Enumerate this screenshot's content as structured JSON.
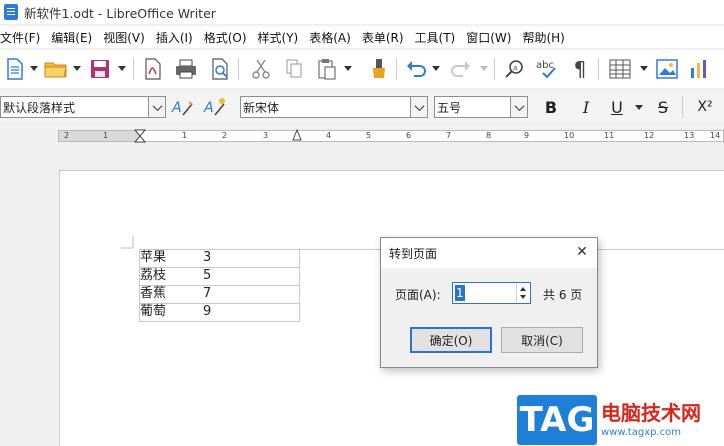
{
  "window": {
    "title": "新软件1.odt - LibreOffice Writer"
  },
  "menu": [
    "文件(F)",
    "编辑(E)",
    "视图(V)",
    "插入(I)",
    "格式(O)",
    "样式(Y)",
    "表格(A)",
    "表单(R)",
    "工具(T)",
    "窗口(W)",
    "帮助(H)"
  ],
  "toolbar": {
    "buttons": [
      {
        "name": "new-document-icon"
      },
      {
        "name": "open-folder-icon"
      },
      {
        "name": "save-icon"
      },
      {
        "name": "export-pdf-icon"
      },
      {
        "name": "print-icon"
      },
      {
        "name": "print-preview-icon"
      },
      {
        "name": "cut-icon"
      },
      {
        "name": "copy-icon"
      },
      {
        "name": "paste-icon"
      },
      {
        "name": "clone-formatting-icon"
      },
      {
        "name": "undo-icon"
      },
      {
        "name": "redo-icon"
      },
      {
        "name": "find-replace-icon"
      },
      {
        "name": "spellcheck-icon"
      },
      {
        "name": "formatting-marks-icon"
      },
      {
        "name": "insert-table-icon"
      },
      {
        "name": "insert-image-icon"
      },
      {
        "name": "insert-chart-icon"
      }
    ],
    "spellcheck_text": "abc",
    "pilcrow": "¶"
  },
  "format_bar": {
    "paragraph_style": "默认段落样式",
    "font_name": "新宋体",
    "font_size": "五号",
    "bold": "B",
    "italic": "I",
    "underline": "U",
    "strikethrough": "S",
    "superscript": "X²"
  },
  "ruler": {
    "numbers": [
      "2",
      "1",
      "1",
      "2",
      "3",
      "4",
      "5",
      "6",
      "7",
      "8",
      "9",
      "10",
      "11",
      "12",
      "13",
      "14"
    ]
  },
  "document": {
    "table": [
      {
        "fruit": "苹果",
        "count": "3"
      },
      {
        "fruit": "荔枝",
        "count": "5"
      },
      {
        "fruit": "香蕉",
        "count": "7"
      },
      {
        "fruit": "葡萄",
        "count": "9"
      }
    ]
  },
  "dialog": {
    "title": "转到页面",
    "close": "✕",
    "page_label": "页面(A):",
    "page_value": "1",
    "total": "共 6 页",
    "ok": "确定(O)",
    "cancel": "取消(C)"
  },
  "watermark": {
    "logo": "TAG",
    "site_name": "电脑技术网",
    "url": "www.tagxp.com"
  },
  "colors": {
    "accent": "#2a73d2",
    "watermark_red": "#d7261e",
    "watermark_blue": "#1f7fd6"
  }
}
